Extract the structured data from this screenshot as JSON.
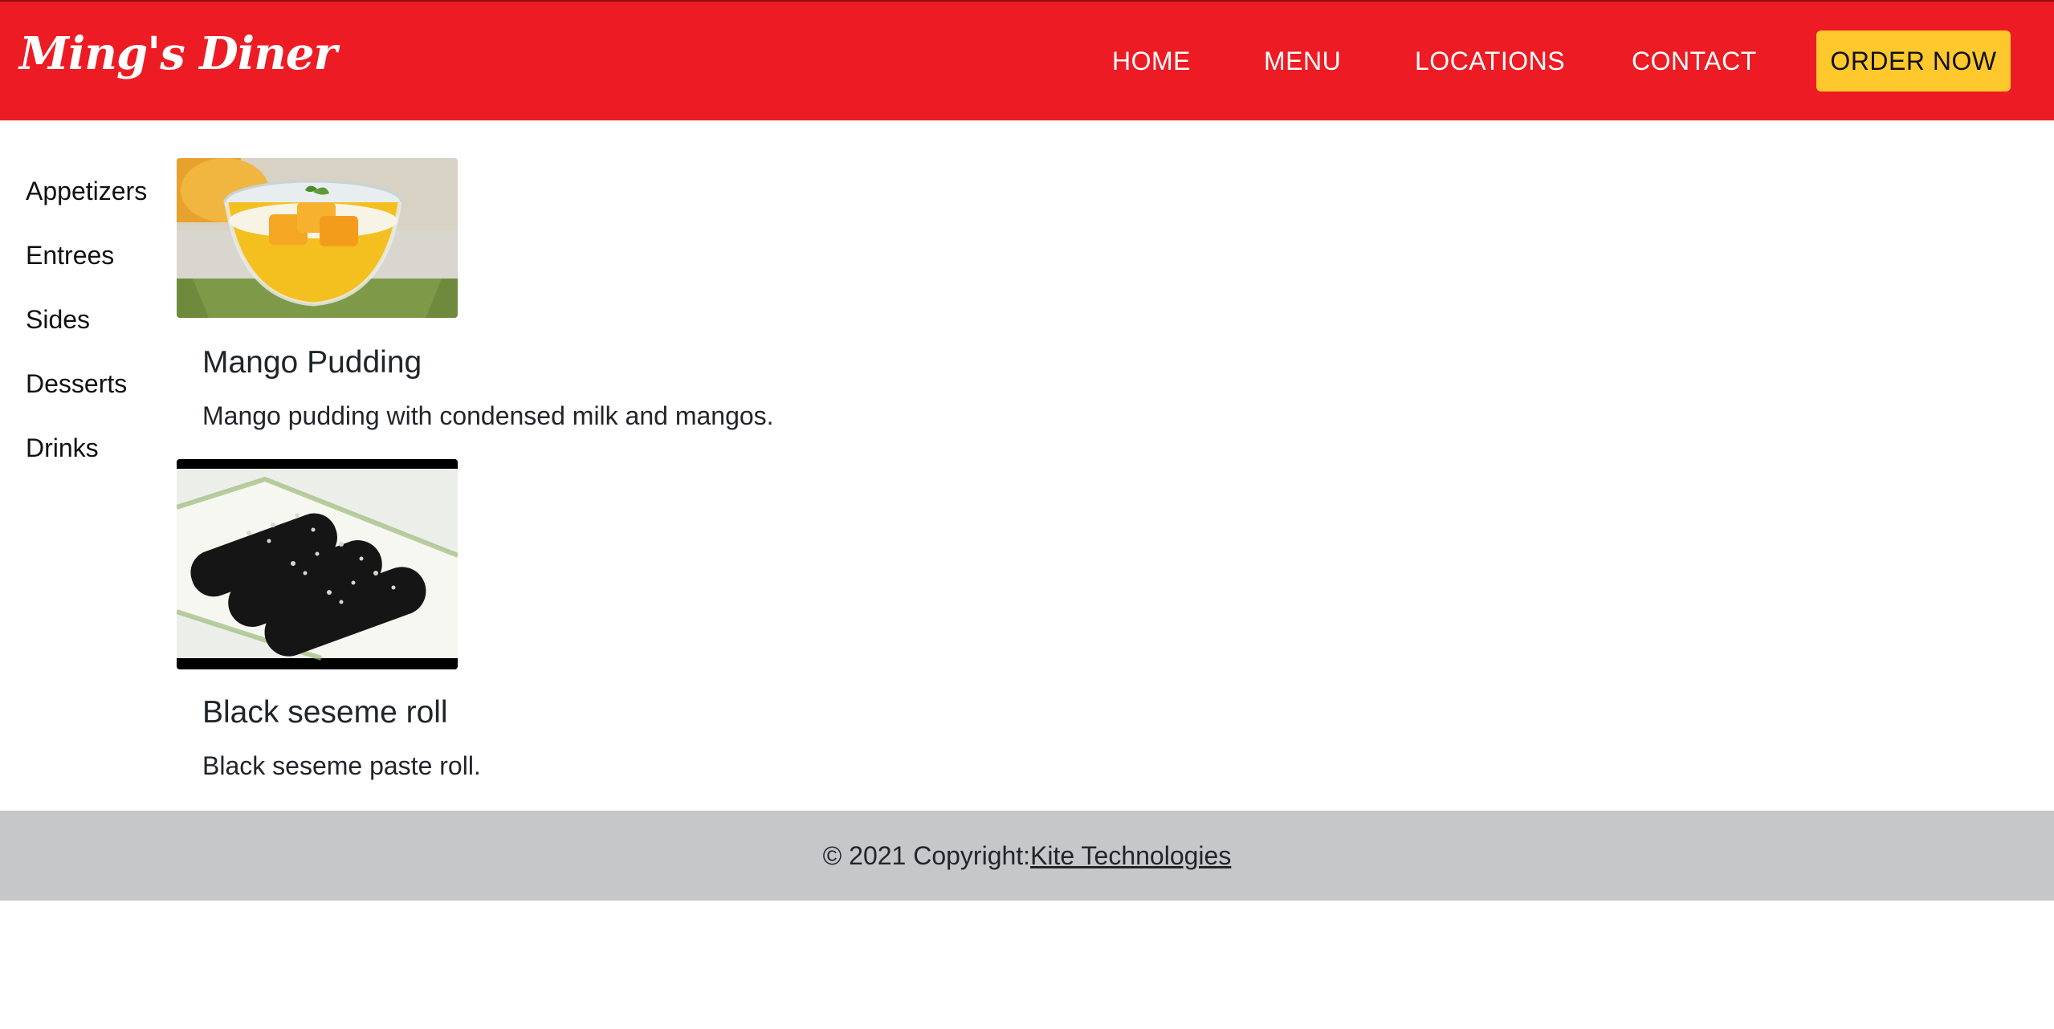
{
  "header": {
    "brand": "Ming's Diner",
    "nav": [
      "HOME",
      "MENU",
      "LOCATIONS",
      "CONTACT"
    ],
    "cta": "ORDER NOW"
  },
  "sidebar": {
    "items": [
      "Appetizers",
      "Entrees",
      "Sides",
      "Desserts",
      "Drinks"
    ]
  },
  "menu_items": [
    {
      "title": "Mango Pudding",
      "description": "Mango pudding with condensed milk and mangos."
    },
    {
      "title": "Black seseme roll",
      "description": "Black seseme paste roll."
    }
  ],
  "footer": {
    "copyright": "© 2021 Copyright: ",
    "company": "Kite Technologies"
  },
  "colors": {
    "header_bg": "#ed1c24",
    "cta_bg": "#ffc82c",
    "footer_bg": "#c6c7c9"
  }
}
